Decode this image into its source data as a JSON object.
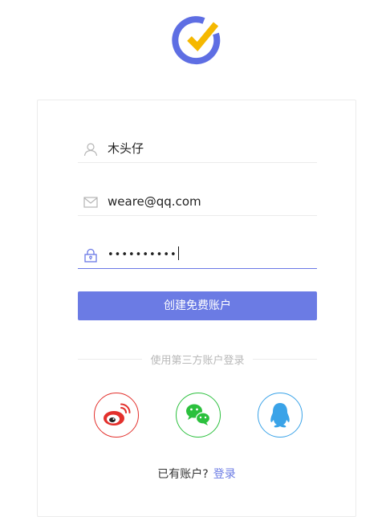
{
  "register_form": {
    "username_value": "木头仔",
    "email_value": "weare@qq.com",
    "password_value": "••••••••••",
    "submit_label": "创建免费账户"
  },
  "third_party": {
    "divider_label": "使用第三方账户登录",
    "providers": [
      {
        "name": "weibo",
        "icon": "weibo-icon",
        "color": "#e3302c"
      },
      {
        "name": "wechat",
        "icon": "wechat-icon",
        "color": "#2bc03d"
      },
      {
        "name": "qq",
        "icon": "qq-icon",
        "color": "#3aa3e8"
      }
    ]
  },
  "footer": {
    "prompt": "已有账户?",
    "login_link": "登录"
  },
  "colors": {
    "accent": "#6b7be4",
    "logo_ring": "#5e6ee3",
    "logo_check": "#f5b800",
    "input_focus": "#6a78e6"
  }
}
